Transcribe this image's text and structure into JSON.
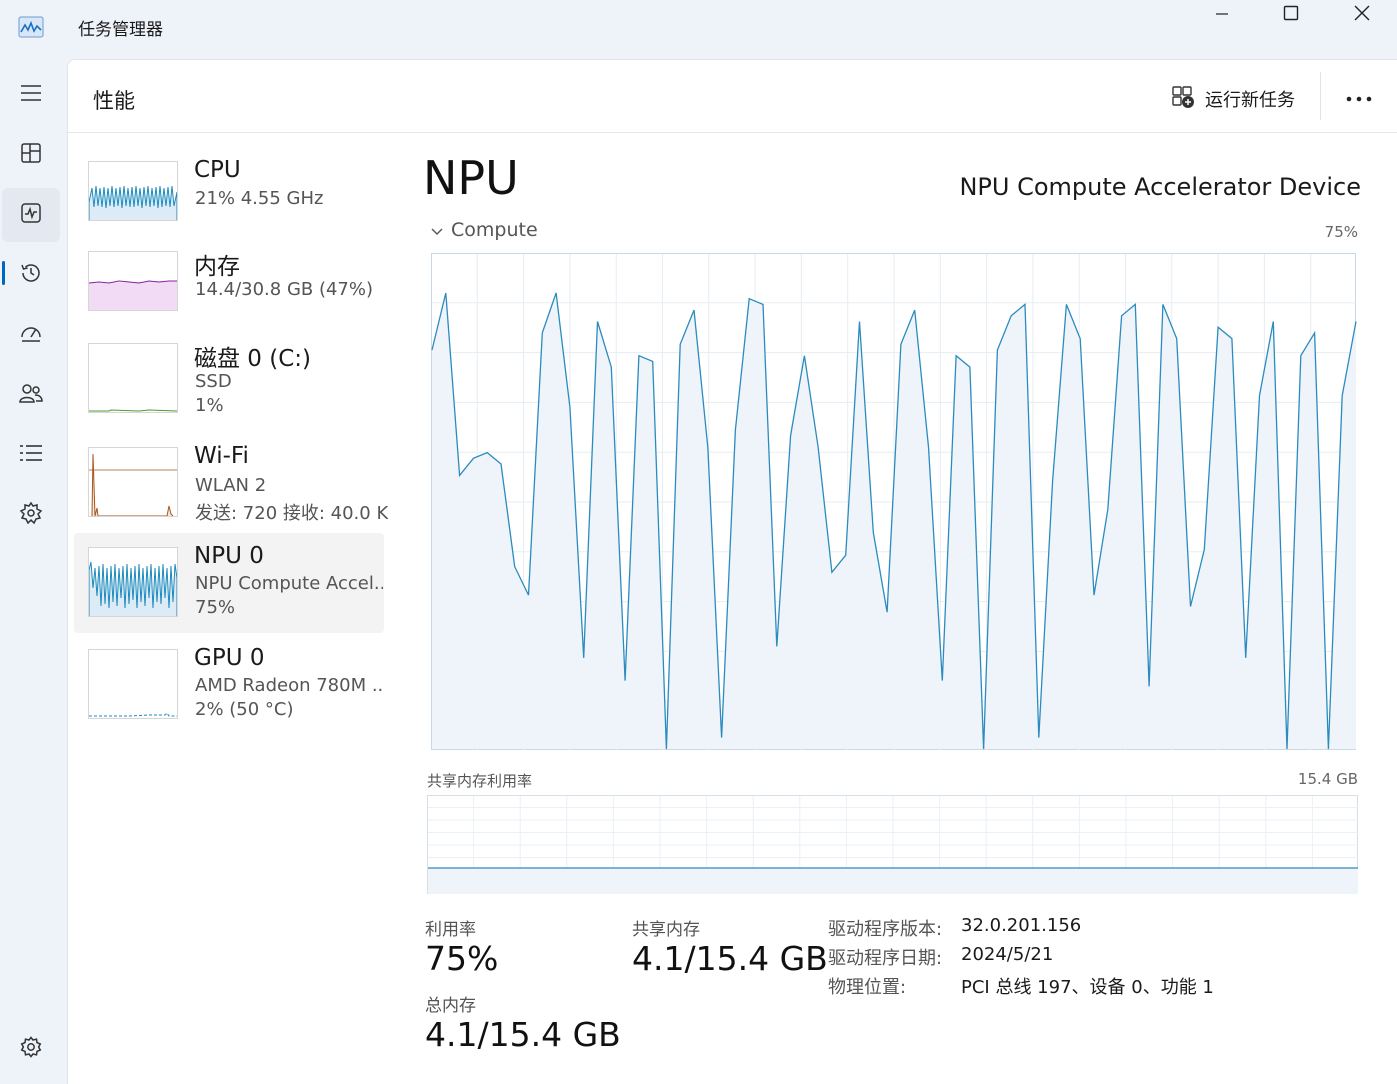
{
  "window": {
    "title": "任务管理器",
    "controls": [
      "minimize-icon",
      "maximize-icon",
      "close-icon"
    ]
  },
  "rail": {
    "items": [
      {
        "name": "hamburger-menu-icon"
      },
      {
        "name": "processes-icon"
      },
      {
        "name": "performance-icon",
        "active": true
      },
      {
        "name": "app-history-icon"
      },
      {
        "name": "startup-apps-icon"
      },
      {
        "name": "users-icon"
      },
      {
        "name": "details-icon"
      },
      {
        "name": "services-icon"
      },
      {
        "name": "settings-icon"
      }
    ]
  },
  "header": {
    "title": "性能",
    "run_task": "运行新任务"
  },
  "devices": [
    {
      "name": "CPU",
      "sub1": "21%  4.55 GHz",
      "sub2": "",
      "color": "#1b8bbd"
    },
    {
      "name": "内存",
      "sub1": "14.4/30.8 GB (47%)",
      "sub2": "",
      "color": "#8b1fa0"
    },
    {
      "name": "磁盘 0 (C:)",
      "sub1": "SSD",
      "sub2": "1%",
      "color": "#4d9b2e"
    },
    {
      "name": "Wi-Fi",
      "sub1": "WLAN 2",
      "sub2": "发送: 720  接收: 40.0 K",
      "color": "#a8561d"
    },
    {
      "name": "NPU 0",
      "sub1": "NPU Compute Accel...",
      "sub2": "75%",
      "color": "#1b8bbd",
      "active": true
    },
    {
      "name": "GPU 0",
      "sub1": "AMD Radeon 780M ...",
      "sub2": "2%  (50 °C)",
      "color": "#1b8bbd"
    }
  ],
  "detail": {
    "title": "NPU",
    "device_name": "NPU Compute Accelerator Device",
    "graph_label": "Compute",
    "graph_max": "75%",
    "shared_mem_label": "共享内存利用率",
    "shared_mem_max": "15.4 GB",
    "stats": {
      "utilization_label": "利用率",
      "utilization_value": "75%",
      "shared_label": "共享内存",
      "shared_value": "4.1/15.4 GB",
      "total_label": "总内存",
      "total_value": "4.1/15.4 GB"
    },
    "info": [
      {
        "label": "驱动程序版本:",
        "value": "32.0.201.156"
      },
      {
        "label": "驱动程序日期:",
        "value": "2024/5/21"
      },
      {
        "label": "物理位置:",
        "value": "PCI 总线 197、设备 0、功能 1"
      }
    ]
  },
  "compute_series": [
    70,
    80,
    48,
    51,
    52,
    50,
    32,
    27,
    73,
    80,
    60,
    16,
    75,
    67,
    12,
    69,
    68,
    0,
    71,
    77,
    53,
    2,
    56,
    79,
    78,
    18,
    55,
    69,
    53,
    31,
    34,
    75,
    38,
    24,
    71,
    77,
    53,
    12,
    69,
    67,
    0,
    70,
    76,
    78,
    2,
    47,
    78,
    72,
    27,
    42,
    76,
    78,
    11,
    78,
    72,
    25,
    35,
    74,
    72,
    16,
    62,
    75,
    0,
    69,
    73,
    0,
    62,
    75
  ]
}
